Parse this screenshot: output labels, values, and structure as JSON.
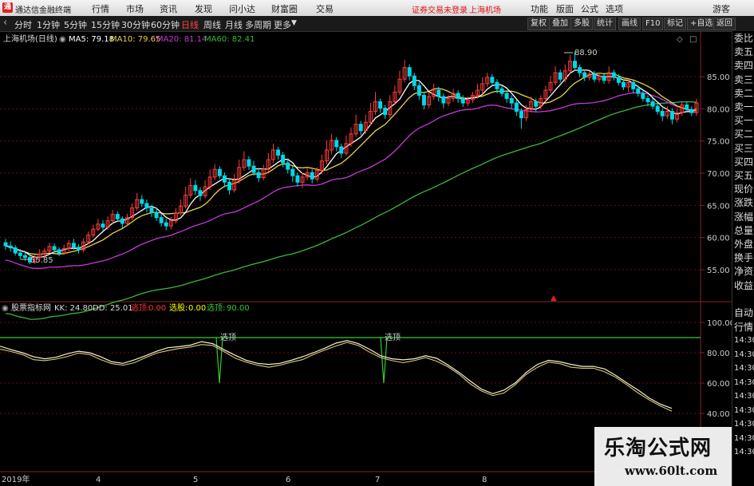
{
  "menubar": {
    "logo": "通",
    "app_title": "通达信金融终端",
    "items": [
      "行情",
      "市场",
      "资讯",
      "发现",
      "问小达",
      "财富圈",
      "交易"
    ],
    "warning": "证券交易未登录",
    "stock_name": "上海机场",
    "right_items": [
      "功能",
      "版面",
      "公式",
      "选项"
    ],
    "guest": "游客"
  },
  "toolbar": {
    "periods": [
      "分时",
      "1分钟",
      "5分钟",
      "15分钟",
      "30分钟",
      "60分钟",
      "日线",
      "周线",
      "月线",
      "多周期",
      "更多"
    ],
    "active_period": "日线",
    "right_buttons": [
      "复权",
      "叠加",
      "多股",
      "统计",
      "画线",
      "F10",
      "标记",
      "+自选",
      "返回"
    ]
  },
  "right_panel": {
    "items": [
      "委比",
      "卖五",
      "卖四",
      "卖三",
      "卖二",
      "卖一",
      "买一",
      "买二",
      "买三",
      "买四",
      "买五",
      "现价",
      "涨跌",
      "涨幅",
      "总量",
      "外盘",
      "换手",
      "净资",
      "收益"
    ],
    "lower_items": [
      "自动",
      "行情",
      "14:30",
      "14:30",
      "14:30",
      "14:30",
      "14:30",
      "14:30",
      "14:30",
      "14:30",
      "14:30"
    ]
  },
  "main_chart": {
    "title": "上海机场(日线)",
    "ma_labels": [
      {
        "text": "MA5: 79.18",
        "color": "#ffffff"
      },
      {
        "text": "MA10: 79.65",
        "color": "#e8d44a"
      },
      {
        "text": "MA20: 81.14",
        "color": "#c43ad6"
      },
      {
        "text": "MA60: 82.41",
        "color": "#3ab83a"
      }
    ],
    "price_axis": [
      "85.00",
      "80.00",
      "75.00",
      "70.00",
      "65.00",
      "60.00",
      "55.00"
    ],
    "high_label": "88.90",
    "low_label": "55.85"
  },
  "indicator": {
    "name": "股票指标网",
    "labels": [
      {
        "text": "KK: 24.80",
        "color": "#dddddd"
      },
      {
        "text": "DD: 25.01",
        "color": "#dddddd"
      },
      {
        "text": "逃顶:",
        "color": "#ff3333"
      },
      {
        "text": "0.00",
        "color": "#ff3333"
      },
      {
        "text": "选股:",
        "color": "#ffff00"
      },
      {
        "text": "0.00",
        "color": "#ffff00"
      },
      {
        "text": "选顶:",
        "color": "#33cc33"
      },
      {
        "text": "90.00",
        "color": "#33cc33"
      }
    ],
    "axis": [
      "100.00",
      "80.00",
      "60.00",
      "40.00"
    ],
    "signal_label": "选顶"
  },
  "date_axis": [
    "2019年",
    "4",
    "5",
    "6",
    "7",
    "8"
  ],
  "watermark": {
    "line1": "乐淘公式网",
    "line2": "www.60lt.com"
  },
  "chart_data": {
    "type": "candlestick",
    "title": "上海机场(日线)",
    "ylim": [
      52,
      91
    ],
    "candles": [
      [
        59.2,
        58.7,
        59.8,
        58.1
      ],
      [
        58.7,
        58.4,
        59.4,
        57.8
      ],
      [
        58.4,
        57.6,
        58.8,
        57.2
      ],
      [
        57.6,
        57.2,
        58.2,
        56.6
      ],
      [
        57.2,
        56.9,
        57.6,
        56.4
      ],
      [
        56.9,
        56.2,
        57.3,
        55.85
      ],
      [
        56.2,
        56.9,
        57.3,
        55.9
      ],
      [
        56.9,
        57.4,
        58.2,
        56.6
      ],
      [
        57.4,
        57.9,
        58.4,
        57.0
      ],
      [
        57.9,
        58.6,
        59.2,
        57.6
      ],
      [
        58.6,
        58.1,
        59.1,
        57.7
      ],
      [
        58.1,
        57.6,
        58.5,
        57.1
      ],
      [
        57.6,
        58.3,
        58.9,
        57.3
      ],
      [
        58.3,
        59.1,
        59.6,
        57.9
      ],
      [
        59.1,
        58.5,
        59.8,
        58.1
      ],
      [
        58.5,
        58.1,
        59.0,
        57.5
      ],
      [
        58.1,
        59.3,
        59.9,
        57.7
      ],
      [
        59.3,
        60.4,
        60.9,
        59.0
      ],
      [
        60.4,
        61.3,
        62.0,
        60.0
      ],
      [
        61.3,
        62.1,
        62.9,
        61.0
      ],
      [
        62.1,
        61.6,
        62.7,
        61.1
      ],
      [
        61.6,
        62.6,
        63.3,
        61.2
      ],
      [
        62.6,
        63.6,
        64.3,
        62.2
      ],
      [
        63.6,
        62.9,
        64.1,
        62.4
      ],
      [
        62.9,
        62.2,
        63.3,
        61.5
      ],
      [
        62.2,
        63.1,
        63.7,
        61.9
      ],
      [
        63.1,
        64.6,
        65.3,
        62.7
      ],
      [
        64.6,
        65.9,
        66.9,
        64.2
      ],
      [
        65.9,
        65.3,
        66.6,
        64.7
      ],
      [
        65.3,
        64.6,
        65.9,
        63.9
      ],
      [
        64.6,
        63.9,
        65.1,
        63.2
      ],
      [
        63.9,
        63.1,
        64.6,
        62.6
      ],
      [
        63.1,
        62.3,
        63.8,
        61.7
      ],
      [
        62.3,
        61.8,
        62.9,
        61.1
      ],
      [
        61.8,
        62.6,
        63.2,
        61.3
      ],
      [
        62.6,
        63.8,
        64.6,
        62.2
      ],
      [
        63.8,
        64.9,
        65.9,
        63.4
      ],
      [
        64.9,
        66.6,
        67.9,
        64.5
      ],
      [
        66.6,
        68.1,
        69.2,
        66.1
      ],
      [
        68.1,
        67.3,
        68.9,
        66.6
      ],
      [
        67.3,
        66.5,
        67.8,
        65.7
      ],
      [
        66.5,
        67.9,
        68.9,
        66.1
      ],
      [
        67.9,
        69.4,
        70.6,
        67.4
      ],
      [
        69.4,
        70.6,
        71.4,
        68.9
      ],
      [
        70.6,
        69.6,
        71.1,
        69.1
      ],
      [
        69.6,
        68.6,
        70.1,
        67.8
      ],
      [
        68.6,
        67.4,
        69.1,
        66.7
      ],
      [
        67.4,
        68.9,
        69.9,
        67.0
      ],
      [
        68.9,
        70.9,
        72.1,
        68.4
      ],
      [
        70.9,
        72.1,
        73.4,
        70.4
      ],
      [
        72.1,
        71.1,
        72.6,
        70.5
      ],
      [
        71.1,
        70.1,
        71.9,
        69.6
      ],
      [
        70.1,
        69.3,
        70.8,
        68.6
      ],
      [
        69.3,
        70.6,
        71.3,
        68.9
      ],
      [
        70.6,
        72.1,
        73.1,
        70.1
      ],
      [
        72.1,
        73.6,
        74.6,
        71.6
      ],
      [
        73.6,
        72.8,
        74.1,
        72.1
      ],
      [
        72.8,
        71.6,
        73.3,
        70.9
      ],
      [
        71.6,
        70.6,
        72.3,
        69.9
      ],
      [
        70.6,
        69.6,
        71.1,
        68.6
      ],
      [
        69.6,
        68.6,
        70.1,
        67.9
      ],
      [
        68.6,
        69.4,
        70.1,
        67.7
      ],
      [
        69.4,
        70.1,
        70.9,
        68.9
      ],
      [
        70.1,
        69.1,
        70.6,
        68.4
      ],
      [
        69.1,
        70.4,
        70.9,
        68.7
      ],
      [
        70.4,
        71.9,
        72.9,
        69.9
      ],
      [
        71.9,
        73.6,
        75.1,
        71.4
      ],
      [
        73.6,
        75.1,
        76.1,
        72.9
      ],
      [
        75.1,
        74.1,
        75.6,
        73.4
      ],
      [
        74.1,
        73.1,
        74.6,
        72.4
      ],
      [
        73.1,
        74.6,
        75.9,
        72.7
      ],
      [
        74.6,
        76.1,
        77.1,
        74.1
      ],
      [
        76.1,
        77.6,
        79.1,
        75.6
      ],
      [
        77.6,
        76.6,
        78.1,
        75.9
      ],
      [
        76.6,
        77.9,
        79.1,
        76.1
      ],
      [
        77.9,
        79.6,
        80.9,
        77.4
      ],
      [
        79.6,
        81.1,
        82.6,
        79.1
      ],
      [
        81.1,
        80.1,
        81.6,
        79.4
      ],
      [
        80.1,
        79.1,
        80.6,
        78.4
      ],
      [
        79.1,
        81.1,
        82.1,
        78.6
      ],
      [
        81.1,
        82.6,
        83.6,
        80.6
      ],
      [
        82.6,
        84.6,
        85.9,
        82.1
      ],
      [
        84.6,
        86.4,
        87.6,
        84.1
      ],
      [
        86.4,
        85.1,
        86.9,
        84.4
      ],
      [
        85.1,
        83.6,
        85.6,
        82.9
      ],
      [
        83.6,
        82.1,
        84.1,
        81.4
      ],
      [
        82.1,
        80.6,
        82.6,
        79.9
      ],
      [
        80.6,
        81.9,
        82.6,
        80.1
      ],
      [
        81.9,
        82.9,
        83.9,
        81.4
      ],
      [
        82.9,
        81.9,
        83.4,
        81.1
      ],
      [
        81.9,
        80.9,
        82.4,
        80.1
      ],
      [
        80.9,
        81.6,
        82.1,
        80.4
      ],
      [
        81.6,
        82.4,
        83.1,
        81.1
      ],
      [
        82.4,
        81.6,
        82.9,
        80.9
      ],
      [
        81.6,
        80.9,
        82.1,
        80.3
      ],
      [
        80.9,
        81.4,
        81.9,
        80.4
      ],
      [
        81.4,
        82.1,
        82.6,
        80.9
      ],
      [
        82.1,
        82.9,
        83.9,
        81.6
      ],
      [
        82.9,
        83.9,
        84.9,
        82.4
      ],
      [
        83.9,
        84.9,
        85.6,
        83.4
      ],
      [
        84.9,
        84.1,
        85.4,
        83.6
      ],
      [
        84.1,
        83.1,
        84.6,
        82.4
      ],
      [
        83.1,
        82.4,
        83.6,
        81.9
      ],
      [
        82.4,
        81.6,
        82.9,
        80.9
      ],
      [
        81.6,
        80.9,
        82.1,
        80.1
      ],
      [
        80.9,
        79.6,
        81.4,
        78.9
      ],
      [
        79.6,
        78.6,
        80.1,
        76.9
      ],
      [
        78.6,
        79.9,
        80.6,
        78.1
      ],
      [
        79.9,
        81.1,
        81.9,
        79.4
      ],
      [
        81.1,
        80.4,
        81.6,
        79.6
      ],
      [
        80.4,
        81.6,
        82.1,
        79.9
      ],
      [
        81.6,
        82.9,
        83.6,
        81.1
      ],
      [
        82.9,
        84.1,
        85.1,
        82.4
      ],
      [
        84.1,
        85.6,
        86.6,
        83.6
      ],
      [
        85.6,
        84.6,
        86.1,
        84.1
      ],
      [
        84.6,
        85.9,
        86.9,
        84.1
      ],
      [
        85.9,
        87.4,
        88.4,
        85.4
      ],
      [
        87.4,
        86.4,
        88.9,
        85.9
      ],
      [
        86.4,
        85.6,
        86.9,
        84.9
      ],
      [
        85.6,
        84.9,
        86.1,
        84.3
      ],
      [
        84.9,
        85.4,
        85.9,
        84.4
      ],
      [
        85.4,
        84.6,
        85.9,
        84.1
      ],
      [
        84.6,
        85.1,
        85.6,
        84.1
      ],
      [
        85.1,
        84.4,
        85.6,
        83.9
      ],
      [
        84.4,
        85.6,
        86.6,
        83.9
      ],
      [
        85.6,
        84.9,
        86.1,
        84.4
      ],
      [
        84.9,
        84.1,
        85.4,
        83.6
      ],
      [
        84.1,
        83.4,
        84.6,
        82.9
      ],
      [
        83.4,
        84.1,
        84.6,
        82.6
      ],
      [
        84.1,
        83.1,
        84.4,
        82.4
      ],
      [
        83.1,
        82.4,
        83.6,
        81.9
      ],
      [
        82.4,
        81.6,
        82.9,
        81.1
      ],
      [
        81.6,
        81.1,
        82.1,
        80.4
      ],
      [
        81.1,
        80.4,
        81.6,
        79.9
      ],
      [
        80.4,
        79.6,
        80.9,
        79.1
      ],
      [
        79.6,
        78.9,
        80.1,
        78.1
      ],
      [
        78.9,
        79.6,
        80.4,
        78.4
      ],
      [
        79.6,
        78.4,
        80.1,
        77.6
      ],
      [
        78.4,
        79.4,
        80.1,
        77.9
      ],
      [
        79.4,
        80.6,
        81.1,
        78.9
      ],
      [
        80.6,
        79.9,
        81.1,
        79.4
      ],
      [
        79.9,
        79.4,
        80.4,
        78.9
      ],
      [
        79.4,
        80.9,
        81.6,
        78.9
      ]
    ]
  }
}
